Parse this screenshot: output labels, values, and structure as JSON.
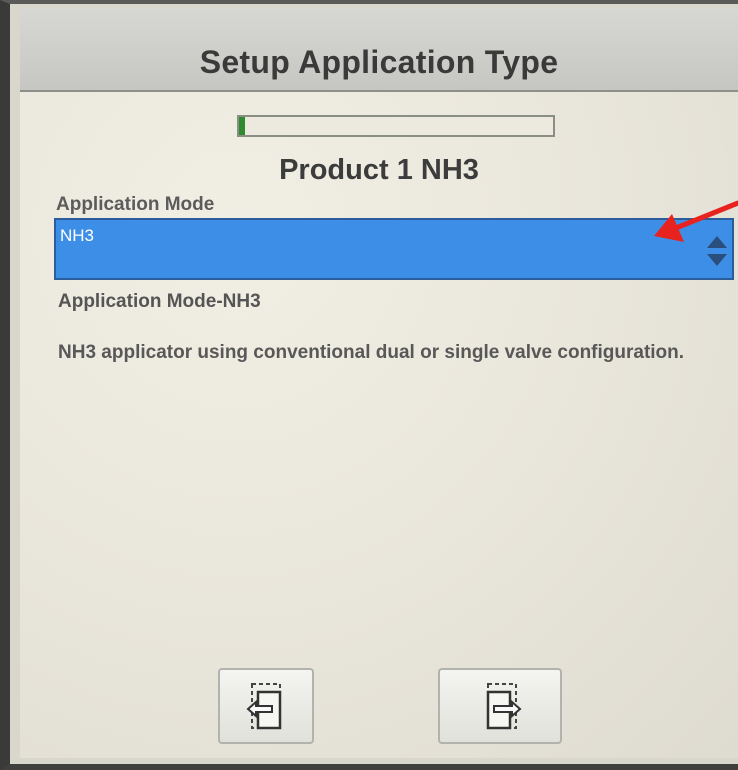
{
  "header": {
    "title": "Setup Application Type"
  },
  "progress": {
    "fraction": 0.02,
    "color": "#2e8a2e"
  },
  "product": {
    "title": "Product 1 NH3"
  },
  "application_mode": {
    "label": "Application Mode",
    "selected_value": "NH3",
    "mode_line": "Application Mode-NH3",
    "description": "NH3 applicator using conventional dual or single valve configuration."
  },
  "colors": {
    "select_bg": "#3d8ee6",
    "annotation_arrow": "#e8231f"
  },
  "icons": {
    "dropdown": "up-down-arrows-icon",
    "previous": "exit-back-icon",
    "next": "enter-forward-icon",
    "annotation": "red-arrow-icon"
  }
}
